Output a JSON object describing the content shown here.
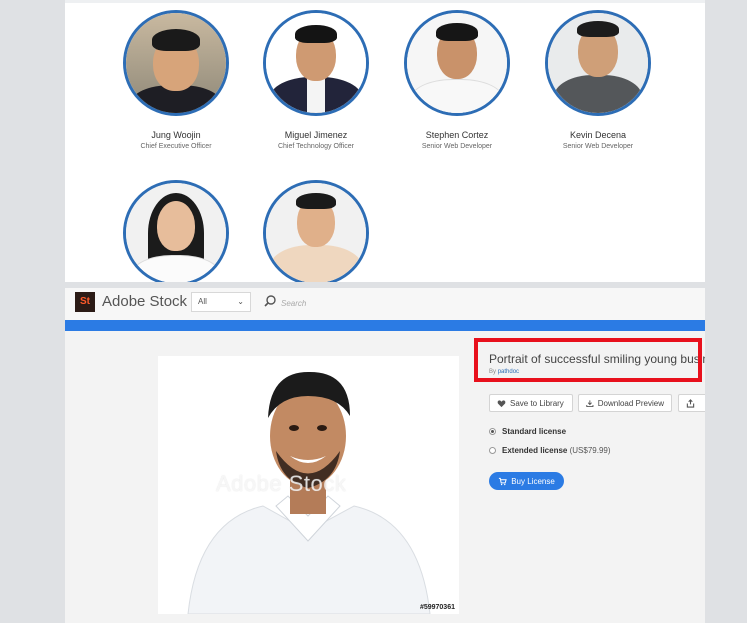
{
  "team": {
    "members": [
      {
        "name": "Jung Woojin",
        "role": "Chief Executive Officer"
      },
      {
        "name": "Miguel Jimenez",
        "role": "Chief Technology Officer"
      },
      {
        "name": "Stephen Cortez",
        "role": "Senior Web Developer"
      },
      {
        "name": "Kevin Decena",
        "role": "Senior Web Developer"
      },
      {
        "name": "",
        "role": ""
      },
      {
        "name": "",
        "role": ""
      }
    ]
  },
  "stock": {
    "logo_text": "St",
    "brand": "Adobe Stock",
    "filter_value": "All",
    "search_placeholder": "Search",
    "watermark": "Adobe Stock",
    "asset_id": "#59970361",
    "title": "Portrait of successful smiling young busine",
    "author_prefix": "By",
    "author": "pathdoc",
    "actions": {
      "save": "Save to Library",
      "download": "Download Preview"
    },
    "licenses": [
      {
        "label": "Standard license",
        "price": "",
        "selected": true
      },
      {
        "label": "Extended license",
        "price": "(US$79.99)",
        "selected": false
      }
    ],
    "buy_label": "Buy License",
    "colors": {
      "accent": "#2b7be4",
      "highlight": "#e8101c",
      "avatar_ring": "#2d6db5"
    }
  }
}
